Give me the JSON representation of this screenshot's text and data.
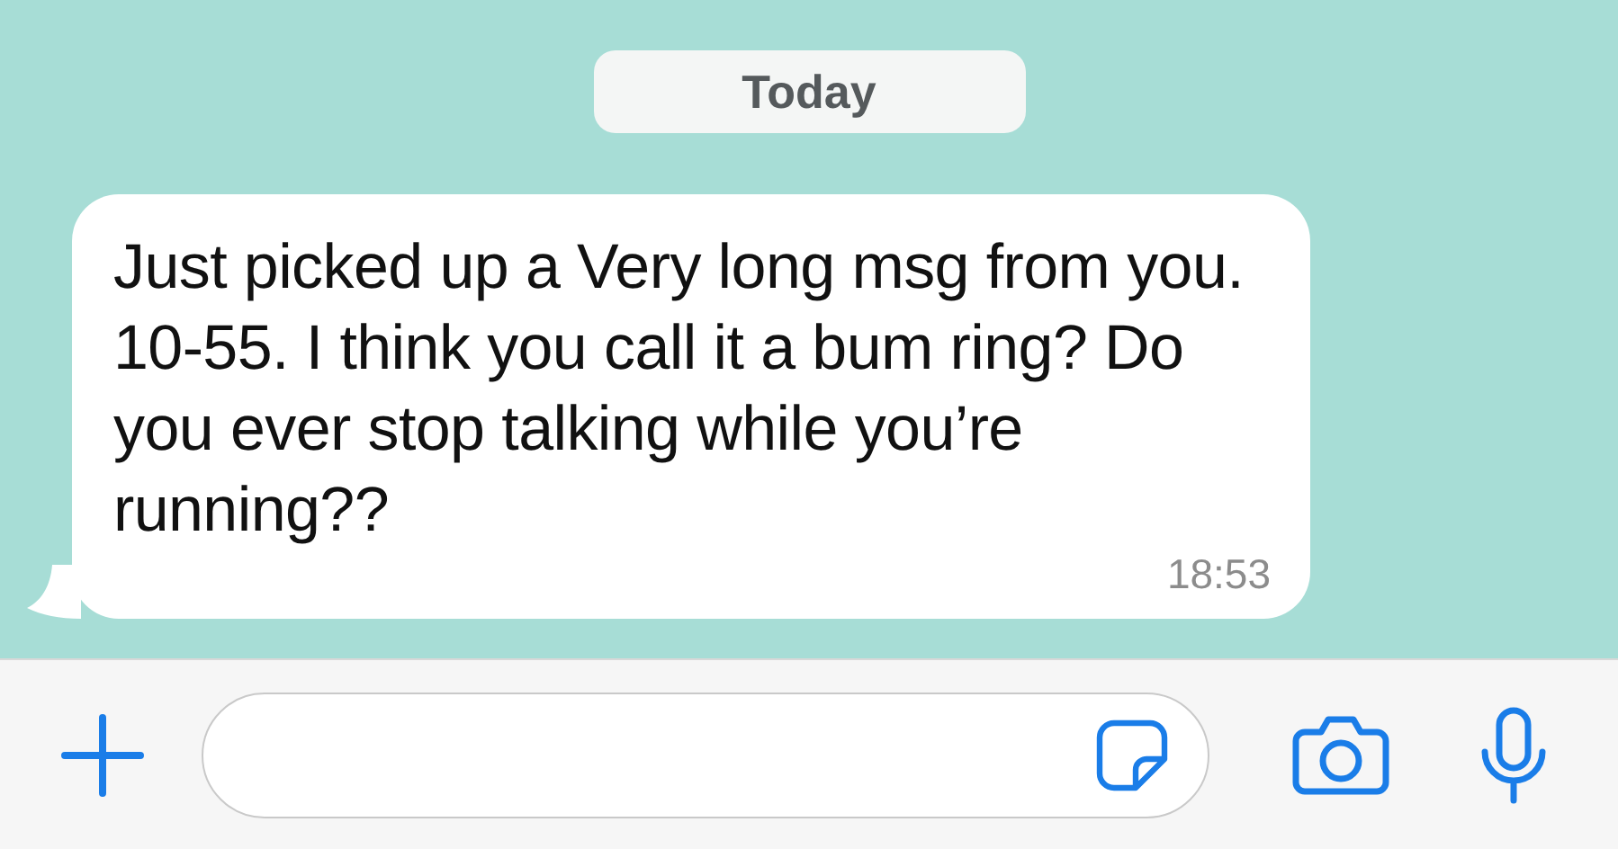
{
  "date_divider": "Today",
  "messages": [
    {
      "text": "Just picked up a Very long msg from you. 10-55. I think you call it a bum ring? Do you ever stop talking while you’re running??",
      "time": "18:53"
    }
  ]
}
